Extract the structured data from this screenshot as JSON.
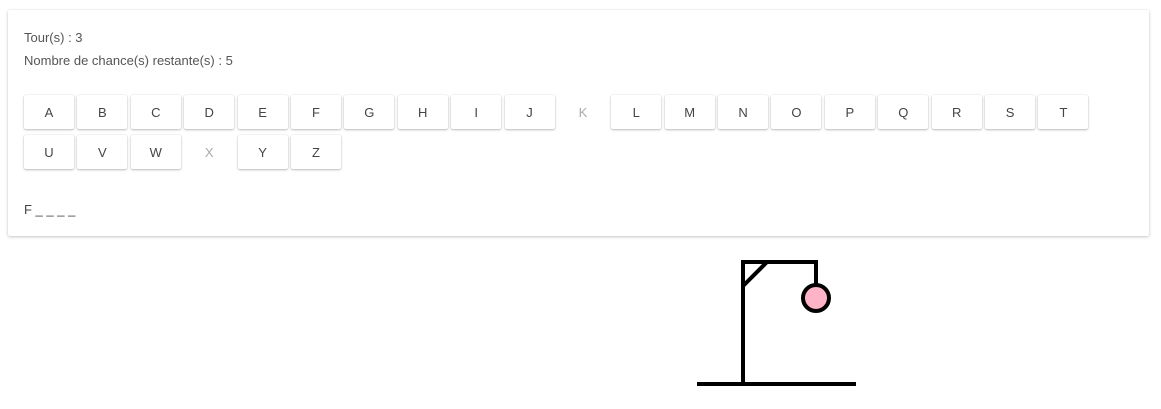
{
  "stats": {
    "turns_label": "Tour(s)",
    "turns_value": "3",
    "chances_label": "Nombre de chance(s) restante(s)",
    "chances_value": "5",
    "separator": " : "
  },
  "keyboard": {
    "row1": [
      {
        "letter": "A",
        "used": false
      },
      {
        "letter": "B",
        "used": false
      },
      {
        "letter": "C",
        "used": false
      },
      {
        "letter": "D",
        "used": false
      },
      {
        "letter": "E",
        "used": false
      },
      {
        "letter": "F",
        "used": false
      },
      {
        "letter": "G",
        "used": false
      },
      {
        "letter": "H",
        "used": false
      },
      {
        "letter": "I",
        "used": false
      },
      {
        "letter": "J",
        "used": false
      },
      {
        "letter": "K",
        "used": true
      },
      {
        "letter": "L",
        "used": false
      },
      {
        "letter": "M",
        "used": false
      },
      {
        "letter": "N",
        "used": false
      },
      {
        "letter": "O",
        "used": false
      },
      {
        "letter": "P",
        "used": false
      },
      {
        "letter": "Q",
        "used": false
      },
      {
        "letter": "R",
        "used": false
      },
      {
        "letter": "S",
        "used": false
      },
      {
        "letter": "T",
        "used": false
      }
    ],
    "row2": [
      {
        "letter": "U",
        "used": false
      },
      {
        "letter": "V",
        "used": false
      },
      {
        "letter": "W",
        "used": false
      },
      {
        "letter": "X",
        "used": true
      },
      {
        "letter": "Y",
        "used": false
      },
      {
        "letter": "Z",
        "used": false
      }
    ]
  },
  "word": "F _ _ _ _",
  "hangman": {
    "head_color": "#ffb3c6",
    "line_color": "#000000"
  }
}
